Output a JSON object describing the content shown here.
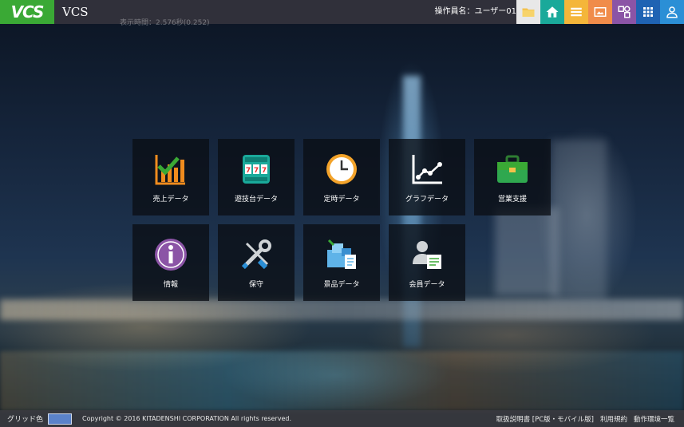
{
  "header": {
    "logo_text": "VCS",
    "title": "VCS",
    "operator_label": "操作員名：ユーザー01",
    "icons": [
      {
        "name": "folder-icon",
        "color": "#e8e8e8"
      },
      {
        "name": "home-icon",
        "color": "#1aa99a"
      },
      {
        "name": "list-icon",
        "color": "#f4b63a"
      },
      {
        "name": "image-icon",
        "color": "#f08c4a"
      },
      {
        "name": "shapes-icon",
        "color": "#8b54a6"
      },
      {
        "name": "grid-icon",
        "color": "#1f63b3"
      },
      {
        "name": "user-icon",
        "color": "#2b8fd6"
      }
    ]
  },
  "elapsed_text": "表示時間：2.576秒(0.252)",
  "tiles": [
    {
      "label": "売上データ",
      "icon": "sales-chart-icon"
    },
    {
      "label": "遊技台データ",
      "icon": "slot-machine-icon"
    },
    {
      "label": "定時データ",
      "icon": "clock-icon"
    },
    {
      "label": "グラフデータ",
      "icon": "line-graph-icon"
    },
    {
      "label": "営業支援",
      "icon": "briefcase-icon"
    },
    {
      "label": "情報",
      "icon": "info-icon"
    },
    {
      "label": "保守",
      "icon": "tools-icon"
    },
    {
      "label": "景品データ",
      "icon": "prizes-icon"
    },
    {
      "label": "会員データ",
      "icon": "members-icon"
    }
  ],
  "footer": {
    "grid_label": "グリッド色",
    "grid_color": "#5b82c9",
    "copyright": "Copyright © 2016 KITADENSHI CORPORATION All rights reserved.",
    "links": [
      "取扱説明書 [PC版・モバイル版]",
      "利用規約",
      "動作環境一覧"
    ]
  }
}
